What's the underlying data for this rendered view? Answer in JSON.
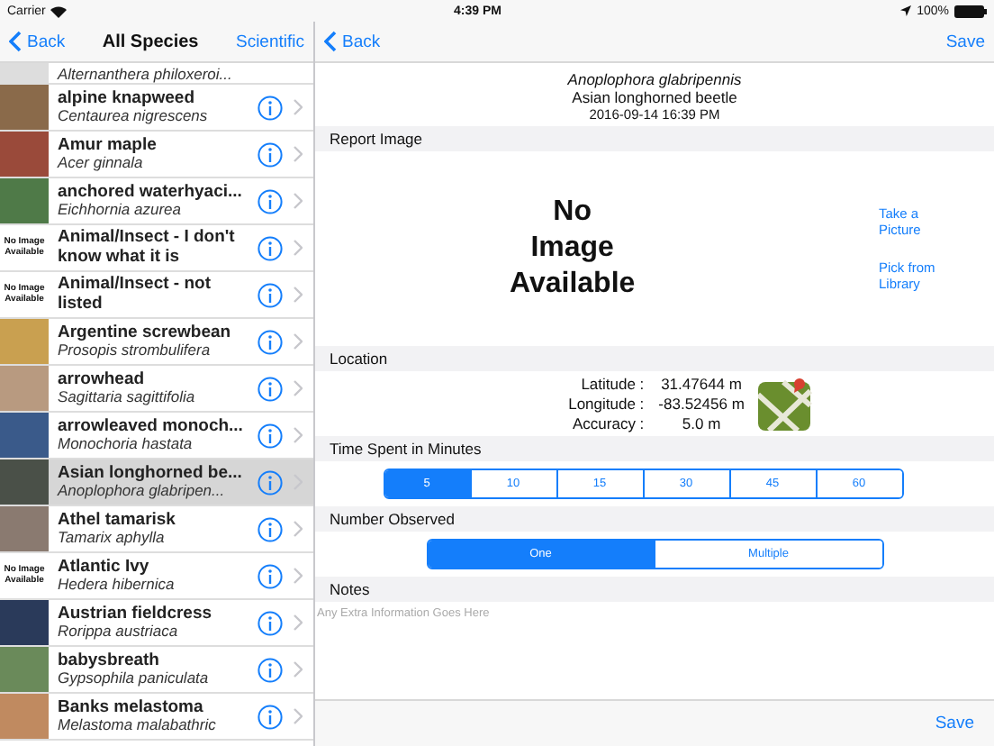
{
  "status_bar": {
    "carrier": "Carrier",
    "time": "4:39 PM",
    "battery": "100%"
  },
  "list_nav": {
    "back": "Back",
    "title": "All Species",
    "right": "Scientific"
  },
  "species_cut": {
    "scientific": "Alternanthera philoxeroi..."
  },
  "species": [
    {
      "name": "alpine knapweed",
      "scientific": "Centaurea nigrescens",
      "thumb": {
        "kind": "photo",
        "color": "#8a6a4a"
      },
      "selected": false
    },
    {
      "name": "Amur maple",
      "scientific": "Acer ginnala",
      "thumb": {
        "kind": "photo",
        "color": "#9a4a3a"
      },
      "selected": false
    },
    {
      "name": "anchored waterhyaci...",
      "scientific": "Eichhornia azurea",
      "thumb": {
        "kind": "photo",
        "color": "#4f7a48"
      },
      "selected": false
    },
    {
      "name": "Animal/Insect - I don't know what it is",
      "thumb": {
        "kind": "no_image",
        "text": "No Image Available"
      },
      "selected": false
    },
    {
      "name": "Animal/Insect - not listed",
      "thumb": {
        "kind": "no_image",
        "text": "No Image Available"
      },
      "selected": false
    },
    {
      "name": "Argentine screwbean",
      "scientific": "Prosopis strombulifera",
      "thumb": {
        "kind": "photo",
        "color": "#c9a050"
      },
      "selected": false
    },
    {
      "name": "arrowhead",
      "scientific": "Sagittaria sagittifolia",
      "thumb": {
        "kind": "photo",
        "color": "#b89a80"
      },
      "selected": false
    },
    {
      "name": "arrowleaved monoch...",
      "scientific": "Monochoria hastata",
      "thumb": {
        "kind": "photo",
        "color": "#3a5a8a"
      },
      "selected": false
    },
    {
      "name": "Asian longhorned be...",
      "scientific": "Anoplophora glabripen...",
      "thumb": {
        "kind": "photo",
        "color": "#4a5048"
      },
      "selected": true
    },
    {
      "name": "Athel tamarisk",
      "scientific": "Tamarix aphylla",
      "thumb": {
        "kind": "photo",
        "color": "#8a7a70"
      },
      "selected": false
    },
    {
      "name": "Atlantic Ivy",
      "scientific": "Hedera hibernica",
      "thumb": {
        "kind": "no_image",
        "text": "No Image Available"
      },
      "selected": false
    },
    {
      "name": "Austrian fieldcress",
      "scientific": "Rorippa austriaca",
      "thumb": {
        "kind": "photo",
        "color": "#2a3a5a"
      },
      "selected": false
    },
    {
      "name": "babysbreath",
      "scientific": "Gypsophila paniculata",
      "thumb": {
        "kind": "photo",
        "color": "#6a8a5a"
      },
      "selected": false
    },
    {
      "name": "Banks melastoma",
      "scientific": "Melastoma malabathric",
      "thumb": {
        "kind": "photo",
        "color": "#c08a60"
      },
      "selected": false
    }
  ],
  "detail_nav": {
    "back": "Back",
    "save": "Save"
  },
  "header": {
    "scientific": "Anoplophora glabripennis",
    "common": "Asian longhorned beetle",
    "date": "2016-09-14 16:39 PM"
  },
  "report_image": {
    "title": "Report Image",
    "image_text": "No Image Available",
    "actions": [
      "Take a Picture",
      "Pick from Library"
    ]
  },
  "location": {
    "title": "Location",
    "rows": [
      {
        "label": "Latitude :",
        "value": "31.47644 m"
      },
      {
        "label": "Longitude :",
        "value": "-83.52456 m"
      },
      {
        "label": "Accuracy :",
        "value": "5.0 m"
      }
    ]
  },
  "time_spent": {
    "title": "Time Spent in Minutes",
    "options": [
      {
        "label": "5",
        "selected": true
      },
      {
        "label": "10",
        "selected": false
      },
      {
        "label": "15",
        "selected": false
      },
      {
        "label": "30",
        "selected": false
      },
      {
        "label": "45",
        "selected": false
      },
      {
        "label": "60",
        "selected": false
      }
    ]
  },
  "number_observed": {
    "title": "Number Observed",
    "options": [
      {
        "label": "One",
        "selected": true
      },
      {
        "label": "Multiple",
        "selected": false
      }
    ]
  },
  "notes": {
    "title": "Notes",
    "placeholder": "Any Extra Information Goes Here"
  },
  "toolbar": {
    "save": "Save"
  }
}
